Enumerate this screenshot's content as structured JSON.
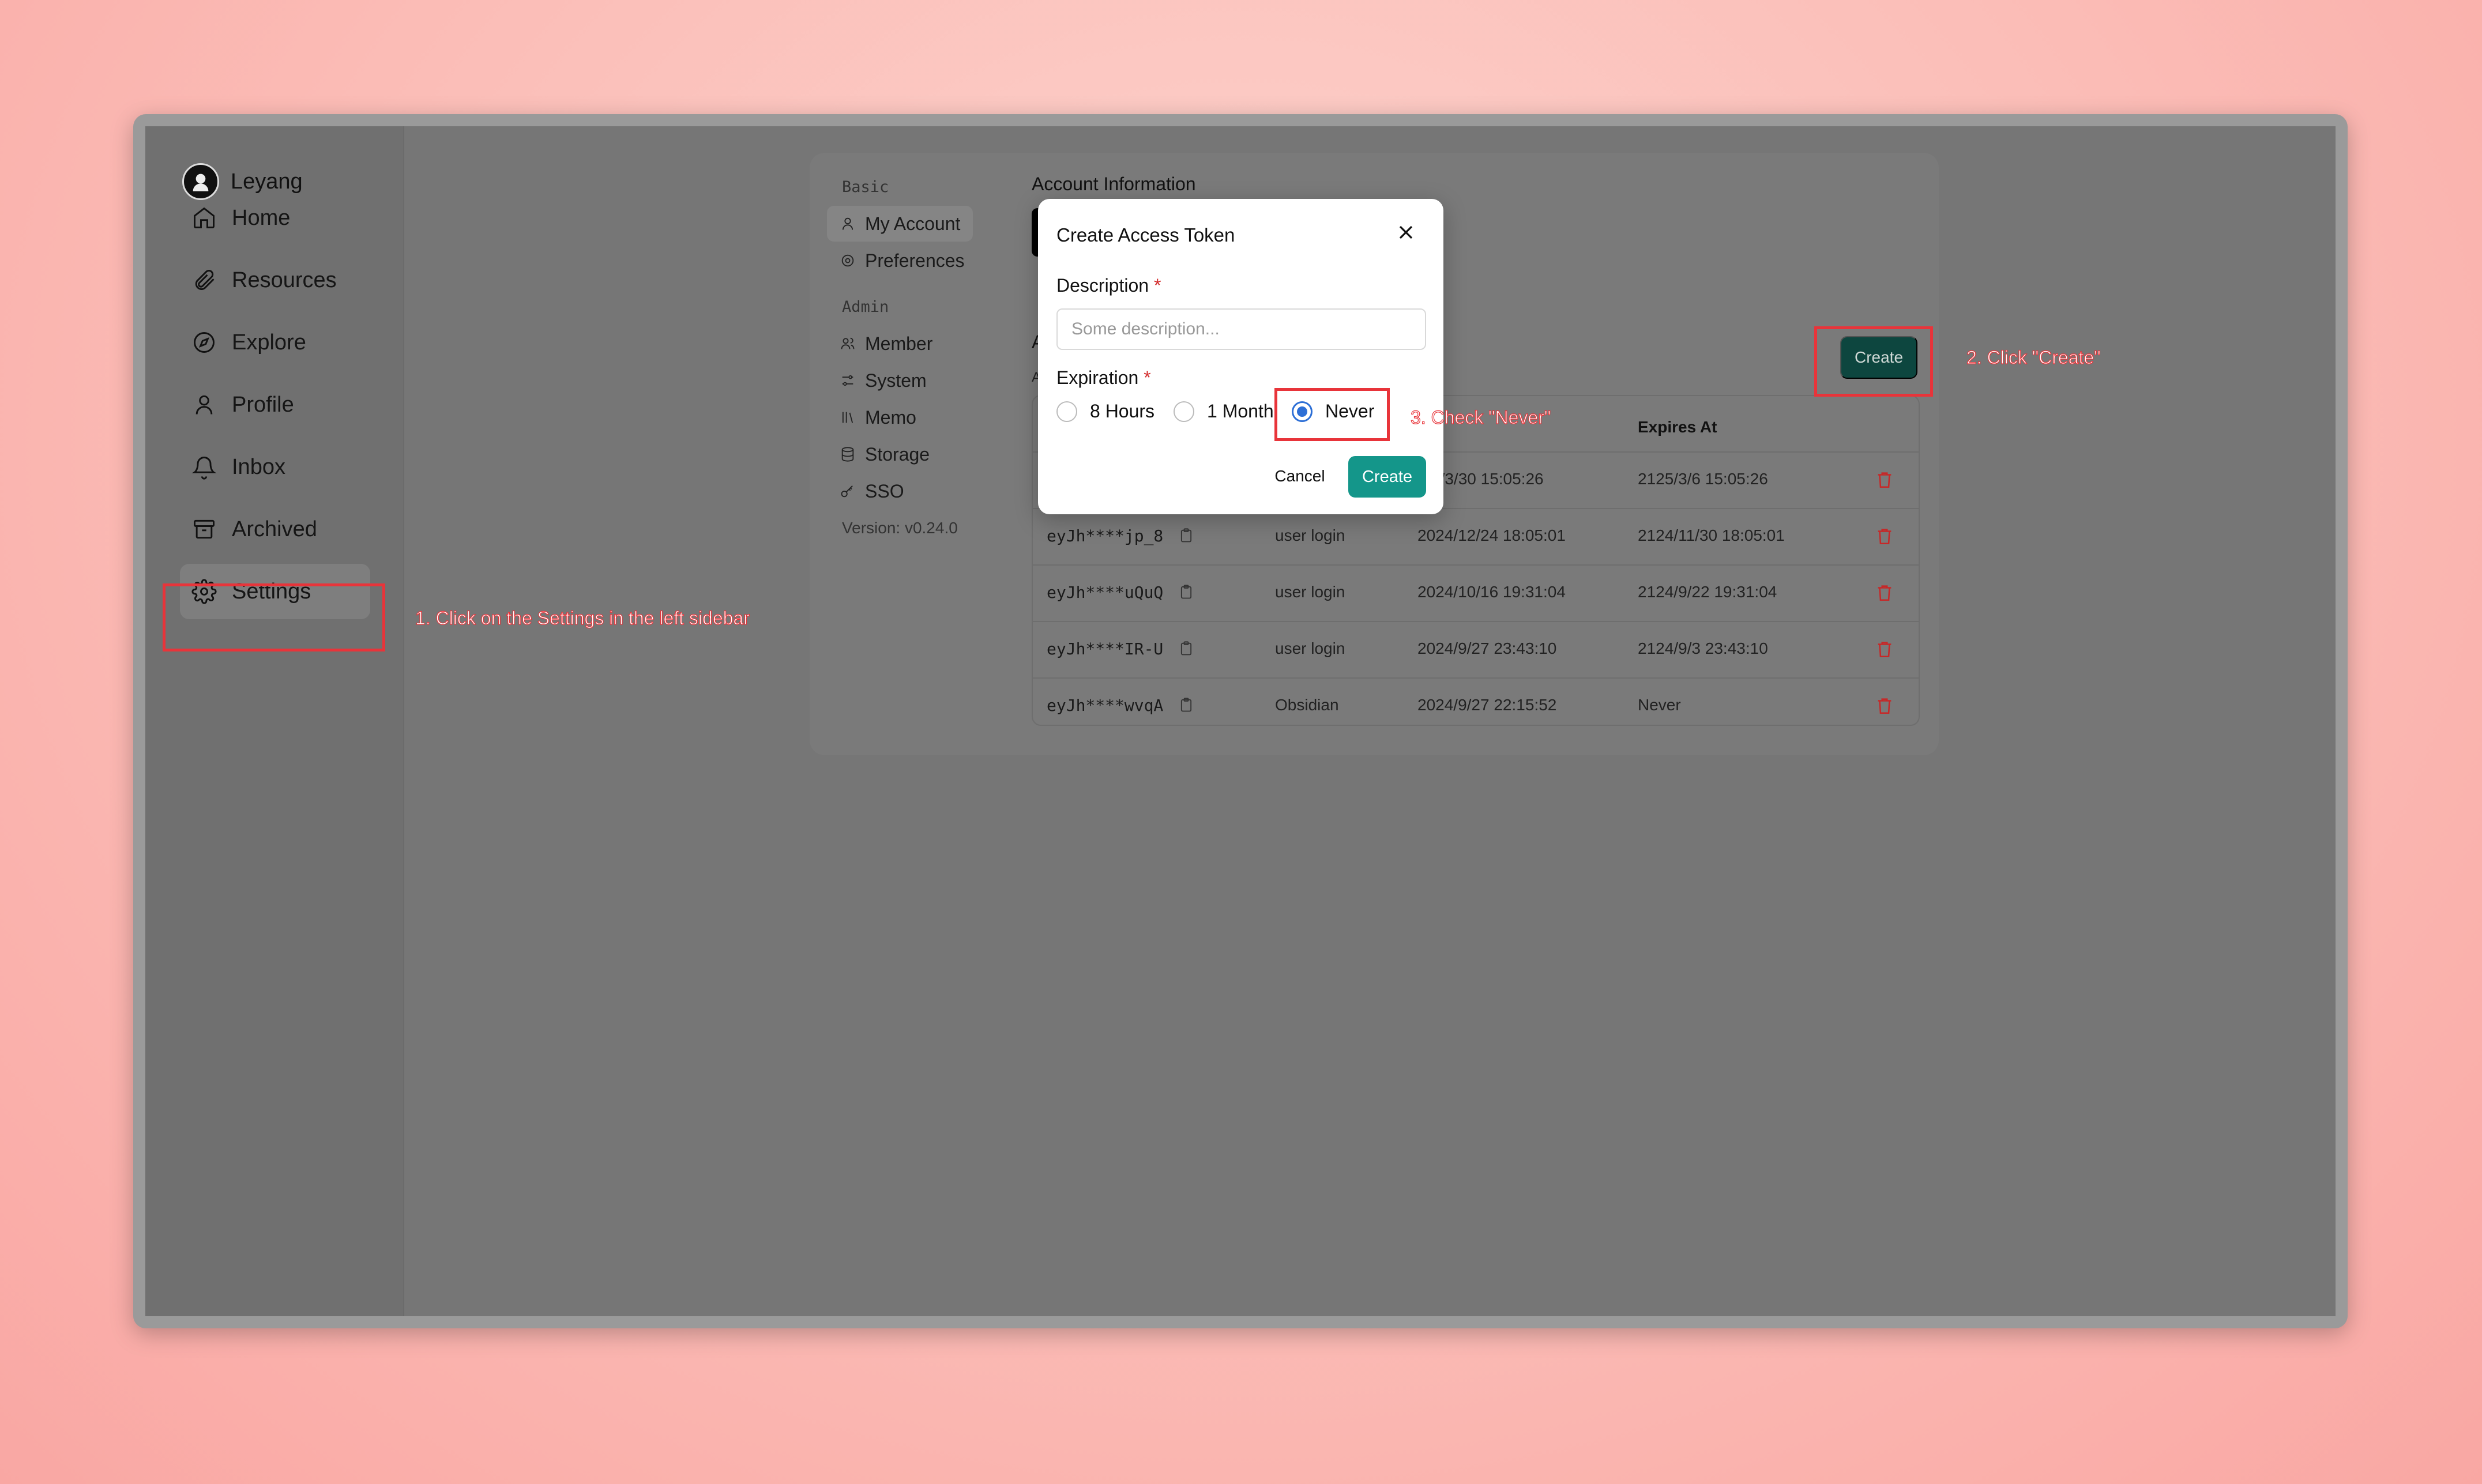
{
  "brand": {
    "name": "Leyang"
  },
  "sidebar": {
    "items": [
      {
        "label": "Home",
        "icon": "home-icon"
      },
      {
        "label": "Resources",
        "icon": "paperclip-icon"
      },
      {
        "label": "Explore",
        "icon": "compass-icon"
      },
      {
        "label": "Profile",
        "icon": "user-icon"
      },
      {
        "label": "Inbox",
        "icon": "bell-icon"
      },
      {
        "label": "Archived",
        "icon": "archive-icon"
      },
      {
        "label": "Settings",
        "icon": "gear-icon",
        "active": true
      }
    ]
  },
  "settings": {
    "basic_label": "Basic",
    "admin_label": "Admin",
    "basic_items": [
      {
        "label": "My Account",
        "icon": "user-icon",
        "active": true
      },
      {
        "label": "Preferences",
        "icon": "gear-icon"
      }
    ],
    "admin_items": [
      {
        "label": "Member",
        "icon": "users-icon"
      },
      {
        "label": "System",
        "icon": "sliders-icon"
      },
      {
        "label": "Memo",
        "icon": "library-icon"
      },
      {
        "label": "Storage",
        "icon": "database-icon"
      },
      {
        "label": "SSO",
        "icon": "key-icon"
      }
    ],
    "version": "Version: v0.24.0"
  },
  "account": {
    "title": "Account Information",
    "hidden_char_1": "A",
    "hidden_char_2": "A"
  },
  "tokens": {
    "create_label": "Create",
    "headers": {
      "expires_at": "Expires At"
    },
    "partial_first_created": "5/3/30 15:05:26",
    "rows": [
      {
        "token": "",
        "description": "",
        "created": "",
        "expires": "2125/3/6 15:05:26"
      },
      {
        "token": "eyJh****jp_8",
        "description": "user login",
        "created": "2024/12/24 18:05:01",
        "expires": "2124/11/30 18:05:01"
      },
      {
        "token": "eyJh****uQuQ",
        "description": "user login",
        "created": "2024/10/16 19:31:04",
        "expires": "2124/9/22 19:31:04"
      },
      {
        "token": "eyJh****IR-U",
        "description": "user login",
        "created": "2024/9/27 23:43:10",
        "expires": "2124/9/3 23:43:10"
      },
      {
        "token": "eyJh****wvqA",
        "description": "Obsidian",
        "created": "2024/9/27 22:15:52",
        "expires": "Never"
      }
    ]
  },
  "modal": {
    "title": "Create Access Token",
    "description_label": "Description",
    "description_placeholder": "Some description...",
    "description_value": "",
    "expiration_label": "Expiration",
    "required_mark": "*",
    "options": [
      "8 Hours",
      "1 Month",
      "Never"
    ],
    "selected": "Never",
    "cancel_label": "Cancel",
    "create_label": "Create"
  },
  "annotations": {
    "step1": "1. Click on the Settings in the left sidebar",
    "step2": "2. Click \"Create\"",
    "step3": "3. Check \"Never\"",
    "color": "#e8343a"
  },
  "colors": {
    "accent": "#14968a",
    "dark_button": "#0d463f",
    "radio_selected": "#2d6fd6",
    "danger": "#d32f2f"
  }
}
